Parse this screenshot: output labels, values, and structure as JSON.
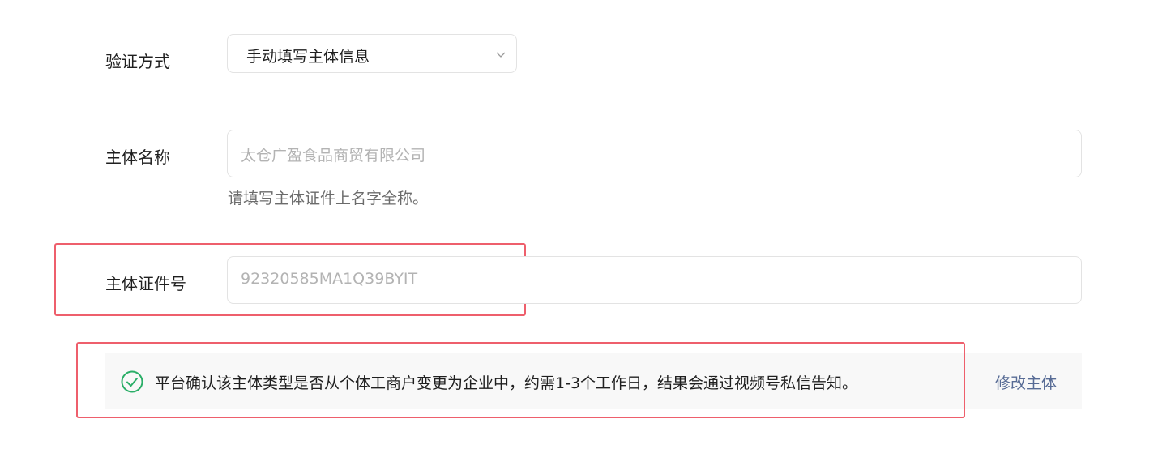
{
  "form": {
    "verify_method": {
      "label": "验证方式",
      "selected": "手动填写主体信息"
    },
    "entity_name": {
      "label": "主体名称",
      "value": "太仓广盈食品商贸有限公司",
      "hint": "请填写主体证件上名字全称。"
    },
    "entity_id": {
      "label": "主体证件号",
      "value": "92320585MA1Q39BYIT"
    }
  },
  "notice": {
    "icon": "check-circle-icon",
    "text": "平台确认该主体类型是否从个体工商户变更为企业中，约需1-3个工作日，结果会通过视频号私信告知。",
    "action_label": "修改主体"
  },
  "colors": {
    "success": "#2aae67",
    "link": "#576b95",
    "highlight": "#ee5f6c",
    "placeholder_text": "#b3b3b3"
  }
}
